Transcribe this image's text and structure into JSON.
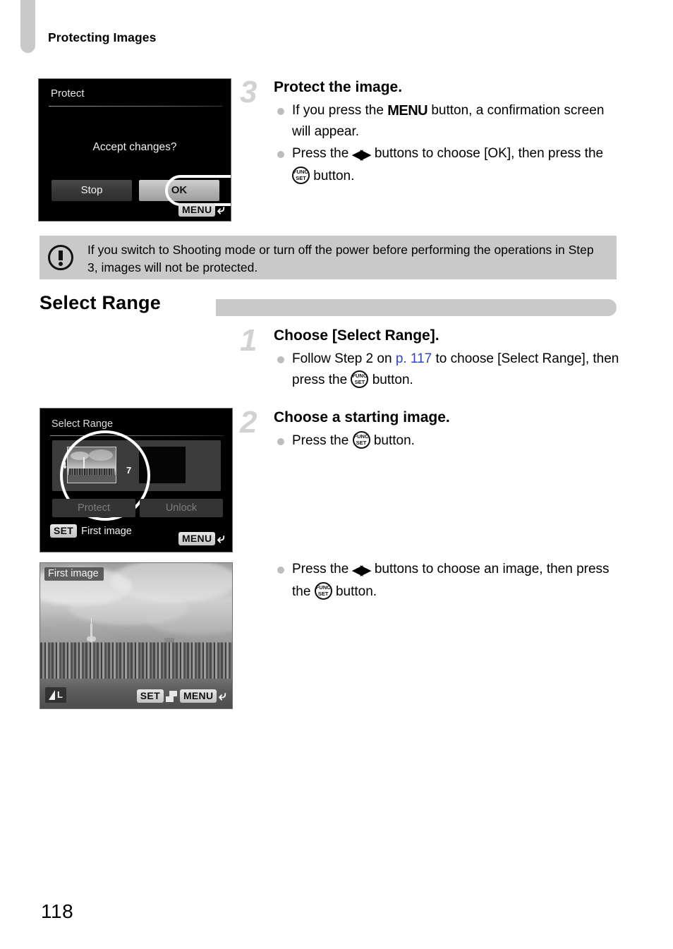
{
  "page": {
    "running_head": "Protecting Images",
    "folio": "118",
    "accent_link_color": "#2b43d6",
    "panel_gray": "#c9c9c9"
  },
  "screens": {
    "protect_confirm": {
      "title": "Protect",
      "question": "Accept changes?",
      "button_stop": "Stop",
      "button_ok": "OK",
      "menu_chip": "MENU",
      "return_arrow": "return-arrow-icon"
    },
    "select_range": {
      "title": "Select Range",
      "marker_left": "4",
      "marker_right": "7",
      "button_protect": "Protect",
      "button_unlock": "Unlock",
      "set_chip": "SET",
      "footer_label": "First image",
      "menu_chip": "MENU",
      "return_arrow": "return-arrow-icon"
    },
    "first_image": {
      "label": "First image",
      "quality_badge": "L",
      "set_chip": "SET",
      "select_icon": "image-select-icon",
      "menu_chip": "MENU",
      "return_arrow": "return-arrow-icon"
    }
  },
  "steps": [
    {
      "number": "3",
      "title": "Protect the image.",
      "bullets": [
        {
          "parts": [
            {
              "t": "text",
              "v": "If you press the "
            },
            {
              "t": "menu",
              "v": "MENU"
            },
            {
              "t": "text",
              "v": " button, a confirmation screen will appear."
            }
          ]
        },
        {
          "parts": [
            {
              "t": "text",
              "v": "Press the "
            },
            {
              "t": "lr",
              "v": "left-right-buttons-icon"
            },
            {
              "t": "text",
              "v": " buttons to choose [OK], then press the "
            },
            {
              "t": "func",
              "v": "FUNC SET"
            },
            {
              "t": "text",
              "v": " button."
            }
          ]
        }
      ]
    },
    {
      "number": "1",
      "title": "Choose [Select Range].",
      "bullets": [
        {
          "parts": [
            {
              "t": "text",
              "v": "Follow Step 2 on "
            },
            {
              "t": "link",
              "v": "p. 117"
            },
            {
              "t": "text",
              "v": " to choose [Select Range], then press the "
            },
            {
              "t": "func",
              "v": "FUNC SET"
            },
            {
              "t": "text",
              "v": " button."
            }
          ]
        }
      ]
    },
    {
      "number": "2",
      "title": "Choose a starting image.",
      "bullets": [
        {
          "parts": [
            {
              "t": "text",
              "v": "Press the "
            },
            {
              "t": "func",
              "v": "FUNC SET"
            },
            {
              "t": "text",
              "v": " button."
            }
          ]
        }
      ]
    }
  ],
  "trailing_bullet": {
    "parts": [
      {
        "t": "text",
        "v": "Press the "
      },
      {
        "t": "lr",
        "v": "left-right-buttons-icon"
      },
      {
        "t": "text",
        "v": " buttons to choose an image, then press the "
      },
      {
        "t": "func",
        "v": "FUNC SET"
      },
      {
        "t": "text",
        "v": " button."
      }
    ]
  },
  "note": {
    "icon": "exclamation-icon",
    "text": "If you switch to Shooting mode or turn off the power before performing the operations in Step 3, images will not be protected."
  },
  "section": {
    "title": "Select Range"
  }
}
